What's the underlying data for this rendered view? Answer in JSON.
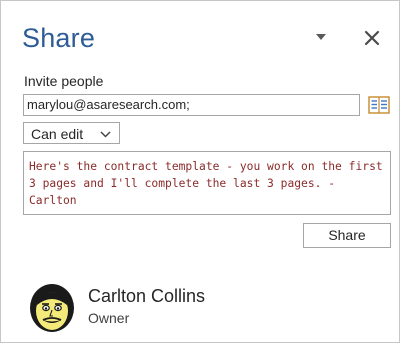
{
  "pane": {
    "title": "Share",
    "menu_icon": "chevron-down-icon",
    "close_icon": "close-icon"
  },
  "invite": {
    "label": "Invite people",
    "value": "marylou@asaresearch.com;",
    "address_book_icon": "address-book-icon"
  },
  "permission": {
    "selected": "Can edit"
  },
  "message": {
    "text": "Here's the contract template - you work on the first 3 pages and I'll complete the last 3 pages. - Carlton"
  },
  "share_button": {
    "label": "Share"
  },
  "owner": {
    "name": "Carlton Collins",
    "role": "Owner"
  },
  "colors": {
    "title": "#2e5c96",
    "message_text": "#8b2b2b",
    "border": "#a6a6a6"
  }
}
